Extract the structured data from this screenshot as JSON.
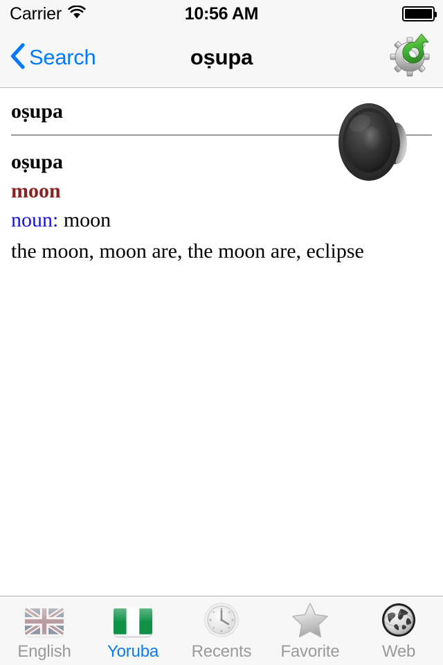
{
  "status_bar": {
    "carrier": "Carrier",
    "wifi_icon": "wifi-icon",
    "time": "10:56 AM",
    "battery_icon": "battery-full-icon"
  },
  "nav_bar": {
    "back_icon": "chevron-left-icon",
    "back_label": "Search",
    "title": "oṣupa",
    "right_icon": "gear-refresh-icon"
  },
  "entry": {
    "headword_top": "oṣupa",
    "headword_main": "oṣupa",
    "translation": "moon",
    "part_of_speech": "noun:",
    "sense_gloss": "moon",
    "examples": "the moon, moon are, the moon are, eclipse",
    "speaker_icon": "speaker-icon"
  },
  "tab_bar": {
    "tabs": [
      {
        "label": "English",
        "icon": "uk-flag-icon",
        "active": false
      },
      {
        "label": "Yoruba",
        "icon": "nigeria-flag-icon",
        "active": true
      },
      {
        "label": "Recents",
        "icon": "clock-icon",
        "active": false
      },
      {
        "label": "Favorite",
        "icon": "star-icon",
        "active": false
      },
      {
        "label": "Web",
        "icon": "globe-icon",
        "active": false
      }
    ]
  },
  "colors": {
    "accent_blue": "#007aff",
    "translation_red": "#8b2122",
    "pos_blue": "#1414e6",
    "bar_background": "#f7f7f7",
    "inactive_label": "#9a9a9a",
    "flag_green": "#0f9247"
  }
}
